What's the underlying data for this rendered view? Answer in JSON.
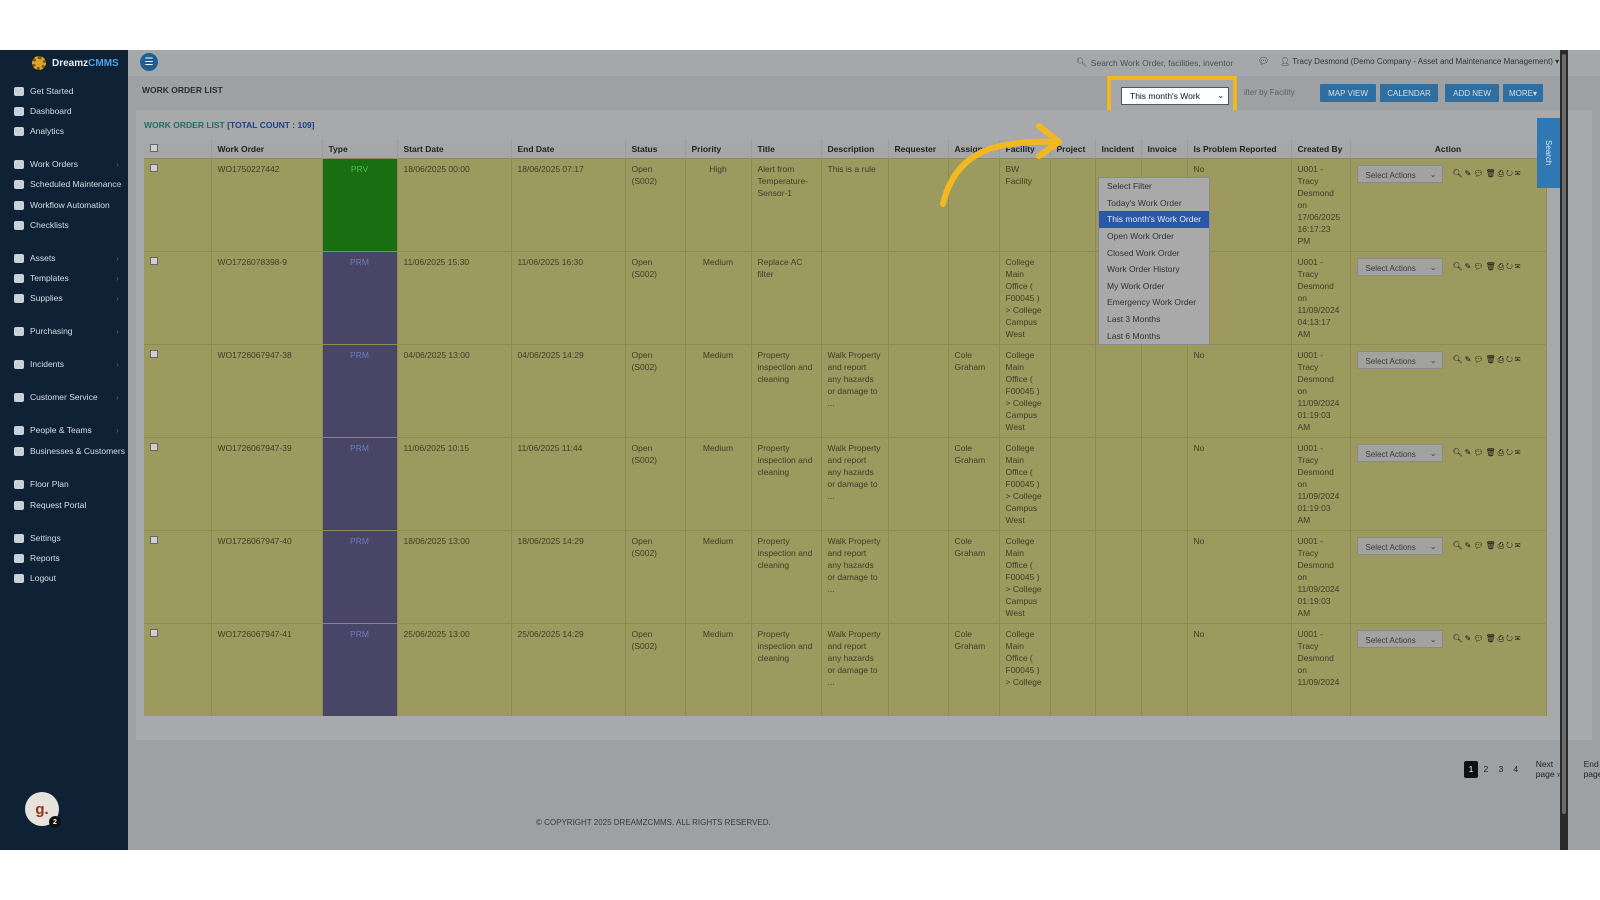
{
  "app": {
    "logo_main": "Dreamz",
    "logo_accent": "CMMS",
    "title": "WORK ORDER LIST"
  },
  "sidebar": {
    "items": [
      {
        "label": "Get Started",
        "icon": "rocket-icon"
      },
      {
        "label": "Dashboard",
        "icon": "dashboard-icon"
      },
      {
        "label": "Analytics",
        "icon": "chart-icon"
      },
      {
        "label": "Work Orders",
        "icon": "wrench-icon"
      },
      {
        "label": "Scheduled Maintenance",
        "icon": "wrench-icon"
      },
      {
        "label": "Workflow Automation",
        "icon": "workflow-icon"
      },
      {
        "label": "Checklists",
        "icon": "checklist-icon"
      },
      {
        "label": "Assets",
        "icon": "assets-icon"
      },
      {
        "label": "Templates",
        "icon": "templates-icon"
      },
      {
        "label": "Supplies",
        "icon": "box-icon"
      },
      {
        "label": "Purchasing",
        "icon": "cart-icon"
      },
      {
        "label": "Incidents",
        "icon": "incident-icon"
      },
      {
        "label": "Customer Service",
        "icon": "customer-service-icon"
      },
      {
        "label": "People & Teams",
        "icon": "people-icon"
      },
      {
        "label": "Businesses & Customers",
        "icon": "business-icon"
      },
      {
        "label": "Floor Plan",
        "icon": "floor-plan-icon"
      },
      {
        "label": "Request Portal",
        "icon": "chat-icon"
      },
      {
        "label": "Settings",
        "icon": "gear-icon"
      },
      {
        "label": "Reports",
        "icon": "report-icon"
      },
      {
        "label": "Logout",
        "icon": "user-icon"
      }
    ],
    "avatar_letter": "g.",
    "avatar_badge": "2"
  },
  "topbar": {
    "search_placeholder": "Search Work Order, facilities, inventor",
    "user": "Tracy Desmond (Demo Company - Asset and Maintenance Management)"
  },
  "toolbar": {
    "filter_value": "This month's Work",
    "facility_placeholder": "ilter by Facility",
    "map_view": "MAP VIEW",
    "calendar": "CALENDAR",
    "add_new": "ADD NEW",
    "more": "MORE"
  },
  "list": {
    "title": "WORK ORDER LIST",
    "count": "[TOTAL COUNT : 109]",
    "columns": [
      "",
      "Work Order",
      "Type",
      "Start Date",
      "End Date",
      "Status",
      "Priority",
      "Title",
      "Description",
      "Requester",
      "Assignee",
      "Facility",
      "Project",
      "Incident",
      "Invoice",
      "Is Problem Reported",
      "Created By",
      "Action"
    ],
    "rows": [
      {
        "wo": "WO1750227442",
        "type": "PRV",
        "start": "18/06/2025 00:00",
        "end": "18/06/2025 07:17",
        "status": "Open (S002)",
        "priority": "High",
        "title": "Alert from Temperature-Sensor-1",
        "description": "This is a rule",
        "requester": "",
        "assignee": "",
        "facility": "BW Facility",
        "problem": "No",
        "created": "U001 - Tracy Desmond on 17/06/2025 16:17:23 PM"
      },
      {
        "wo": "WO1726078398-9",
        "type": "PRM",
        "start": "11/06/2025 15:30",
        "end": "11/06/2025 16:30",
        "status": "Open (S002)",
        "priority": "Medium",
        "title": "Replace AC filter",
        "description": "",
        "requester": "",
        "assignee": "",
        "facility": "College Main Office ( F00045 ) > College Campus West",
        "problem": "",
        "created": "U001 - Tracy Desmond on 11/09/2024 04:13:17 AM"
      },
      {
        "wo": "WO1726067947-38",
        "type": "PRM",
        "start": "04/06/2025 13:00",
        "end": "04/06/2025 14:29",
        "status": "Open (S002)",
        "priority": "Medium",
        "title": "Property inspection and cleaning",
        "description": "Walk Property and report any hazards or damage to ...",
        "requester": "",
        "assignee": "Cole Graham",
        "facility": "College Main Office ( F00045 ) > College Campus West",
        "problem": "No",
        "created": "U001 - Tracy Desmond on 11/09/2024 01:19:03 AM"
      },
      {
        "wo": "WO1726067947-39",
        "type": "PRM",
        "start": "11/06/2025 10:15",
        "end": "11/06/2025 11:44",
        "status": "Open (S002)",
        "priority": "Medium",
        "title": "Property inspection and cleaning",
        "description": "Walk Property and report any hazards or damage to ...",
        "requester": "",
        "assignee": "Cole Graham",
        "facility": "College Main Office ( F00045 ) > College Campus West",
        "problem": "No",
        "created": "U001 - Tracy Desmond on 11/09/2024 01:19:03 AM"
      },
      {
        "wo": "WO1726067947-40",
        "type": "PRM",
        "start": "18/06/2025 13:00",
        "end": "18/06/2025 14:29",
        "status": "Open (S002)",
        "priority": "Medium",
        "title": "Property inspection and cleaning",
        "description": "Walk Property and report any hazards or damage to ...",
        "requester": "",
        "assignee": "Cole Graham",
        "facility": "College Main Office ( F00045 ) > College Campus West",
        "problem": "No",
        "created": "U001 - Tracy Desmond on 11/09/2024 01:19:03 AM"
      },
      {
        "wo": "WO1726067947-41",
        "type": "PRM",
        "start": "25/06/2025 13:00",
        "end": "25/06/2025 14:29",
        "status": "Open (S002)",
        "priority": "Medium",
        "title": "Property inspection and cleaning",
        "description": "Walk Property and report any hazards or damage to ...",
        "requester": "",
        "assignee": "Cole Graham",
        "facility": "College Main Office ( F00045 ) > College",
        "problem": "No",
        "created": "U001 - Tracy Desmond on 11/09/2024"
      }
    ],
    "select_actions": "Select Actions"
  },
  "dropdown": {
    "options": [
      "Select Filter",
      "Today's Work Order",
      "This month's Work Order",
      "Open Work Order",
      "Closed Work Order",
      "Work Order History",
      "My Work Order",
      "Emergency Work Order",
      "Last 3 Months",
      "Last 6 Months"
    ],
    "selected": "This month's Work Order"
  },
  "pagination": {
    "pages": [
      "1",
      "2",
      "3",
      "4"
    ],
    "current": "1",
    "next": "Next page »",
    "end": "End page »"
  },
  "footer": "© COPYRIGHT 2025 DREAMZCMMS. ALL RIGHTS RESERVED.",
  "search_tab": "Search",
  "colors": {
    "highlight": "#f2b820",
    "brand": "#2f6e9e",
    "sidebar": "#0f2235"
  }
}
